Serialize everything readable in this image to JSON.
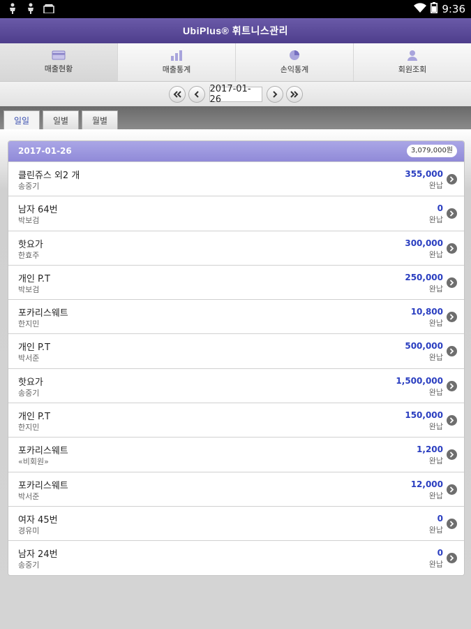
{
  "status_bar": {
    "time": "9:36"
  },
  "app": {
    "title": "UbiPlus® 휘트니스관리"
  },
  "top_tabs": [
    {
      "label": "매출현황",
      "icon": "card-icon"
    },
    {
      "label": "매출통계",
      "icon": "bar-chart-icon"
    },
    {
      "label": "손익통계",
      "icon": "pie-chart-icon"
    },
    {
      "label": "회원조회",
      "icon": "person-icon"
    }
  ],
  "date_nav": {
    "date": "2017-01-26"
  },
  "sub_tabs": [
    {
      "label": "일일"
    },
    {
      "label": "일별"
    },
    {
      "label": "월별"
    }
  ],
  "panel": {
    "date": "2017-01-26",
    "total": "3,079,000원",
    "rows": [
      {
        "name": "클린쥬스 외2 개",
        "sub": "송중기",
        "amount": "355,000",
        "status": "완납"
      },
      {
        "name": "남자 64번",
        "sub": "박보검",
        "amount": "0",
        "status": "완납"
      },
      {
        "name": "핫요가",
        "sub": "한효주",
        "amount": "300,000",
        "status": "완납"
      },
      {
        "name": "개인 P.T",
        "sub": "박보검",
        "amount": "250,000",
        "status": "완납"
      },
      {
        "name": "포카리스웨트",
        "sub": "한지민",
        "amount": "10,800",
        "status": "완납"
      },
      {
        "name": "개인 P.T",
        "sub": "박서준",
        "amount": "500,000",
        "status": "완납"
      },
      {
        "name": "핫요가",
        "sub": "송중기",
        "amount": "1,500,000",
        "status": "완납"
      },
      {
        "name": "개인 P.T",
        "sub": "한지민",
        "amount": "150,000",
        "status": "완납"
      },
      {
        "name": "포카리스웨트",
        "sub": "«비회원»",
        "amount": "1,200",
        "status": "완납"
      },
      {
        "name": "포카리스웨트",
        "sub": "박서준",
        "amount": "12,000",
        "status": "완납"
      },
      {
        "name": "여자 45번",
        "sub": "경유미",
        "amount": "0",
        "status": "완납"
      },
      {
        "name": "남자 24번",
        "sub": "송중기",
        "amount": "0",
        "status": "완납"
      }
    ]
  }
}
